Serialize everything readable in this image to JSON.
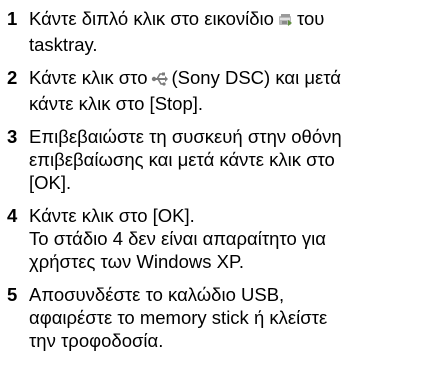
{
  "steps": [
    {
      "number": "1",
      "line1_before_icon": "Κάντε διπλό κλικ στο εικονίδιο",
      "line1_after_icon": "του",
      "line2": "tasktray.",
      "icon": "tasktray-icon"
    },
    {
      "number": "2",
      "line1_before_icon": "Κάντε κλικ στο",
      "line1_after_icon": "(Sony DSC) και μετά",
      "line2": "κάντε κλικ στο [Stop].",
      "icon": "usb-device-icon"
    },
    {
      "number": "3",
      "lines": [
        "Επιβεβαιώστε τη συσκευή στην οθόνη",
        "επιβεβαίωσης και μετά κάντε κλικ στο",
        "[OK]."
      ]
    },
    {
      "number": "4",
      "lines": [
        "Κάντε κλικ στο [OK].",
        "Το στάδιο 4 δεν είναι απαραίτητο για",
        "χρήστες των Windows XP."
      ]
    },
    {
      "number": "5",
      "lines": [
        "Αποσυνδέστε το καλώδιο USB,",
        "αφαιρέστε το memory stick ή κλείστε",
        "την τροφοδοσία."
      ]
    }
  ]
}
